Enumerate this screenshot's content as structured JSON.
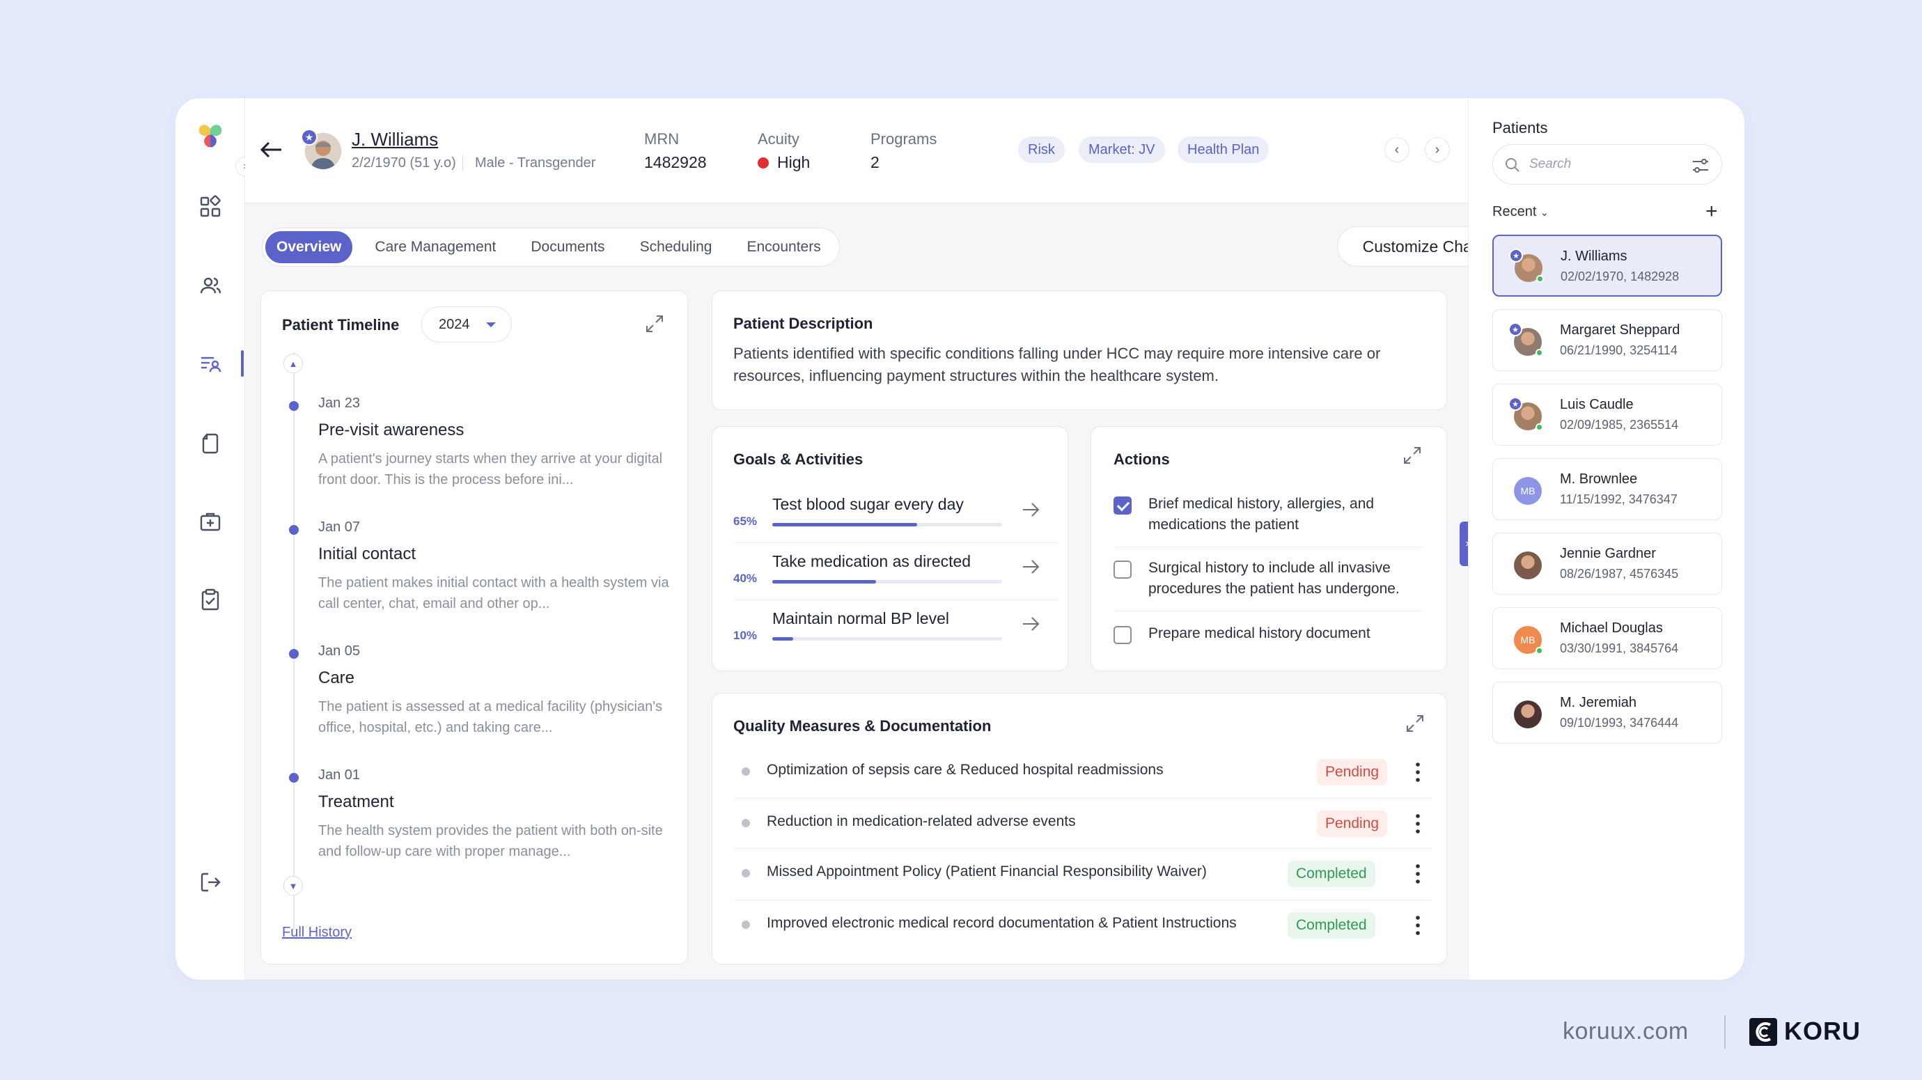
{
  "header": {
    "patient_name": "J. Williams",
    "dob": "2/2/1970 (51 y.o)",
    "gender": "Male - Transgender",
    "mrn_label": "MRN",
    "mrn_value": "1482928",
    "acuity_label": "Acuity",
    "acuity_value": "High",
    "programs_label": "Programs",
    "programs_value": "2",
    "tags": [
      "Risk",
      "Market: JV",
      "Health Plan"
    ]
  },
  "tabs": [
    "Overview",
    "Care Management",
    "Documents",
    "Scheduling",
    "Encounters"
  ],
  "customize_button": "Customize Charts",
  "timeline": {
    "title": "Patient Timeline",
    "year": "2024",
    "items": [
      {
        "date": "Jan 23",
        "title": "Pre-visit awareness",
        "desc": "A patient's journey starts when they arrive at your digital front door. This is the process before ini..."
      },
      {
        "date": "Jan 07",
        "title": "Initial contact",
        "desc": "The patient makes initial contact with a health system via call center, chat, email and other op..."
      },
      {
        "date": "Jan 05",
        "title": "Care",
        "desc": "The patient is assessed at a medical facility (physician's office, hospital, etc.) and taking care..."
      },
      {
        "date": "Jan 01",
        "title": "Treatment",
        "desc": "The health system provides the patient with both on-site and follow-up care with proper manage..."
      }
    ],
    "full_history": "Full History"
  },
  "description": {
    "title": "Patient Description",
    "text": "Patients identified with specific conditions falling under HCC may require more intensive care or resources, influencing payment structures within the healthcare system."
  },
  "goals": {
    "title": "Goals & Activities",
    "items": [
      {
        "pct_label": "65%",
        "progress": 0.63,
        "text": "Test blood sugar every day"
      },
      {
        "pct_label": "40%",
        "progress": 0.45,
        "text": "Take medication as directed"
      },
      {
        "pct_label": "10%",
        "progress": 0.09,
        "text": "Maintain normal BP level"
      }
    ]
  },
  "actions": {
    "title": "Actions",
    "items": [
      {
        "text": "Brief medical history, allergies, and medications the patient",
        "checked": true
      },
      {
        "text": "Surgical history to include all invasive procedures the patient has undergone.",
        "checked": false
      },
      {
        "text": "Prepare medical history document",
        "checked": false
      }
    ]
  },
  "quality": {
    "title": "Quality Measures & Documentation",
    "items": [
      {
        "text": "Optimization of sepsis care & Reduced hospital readmissions",
        "status": "Pending"
      },
      {
        "text": "Reduction in medication-related adverse events",
        "status": "Pending"
      },
      {
        "text": "Missed Appointment Policy (Patient Financial Responsibility Waiver)",
        "status": "Completed"
      },
      {
        "text": "Improved electronic medical record documentation & Patient Instructions",
        "status": "Completed"
      }
    ]
  },
  "patients_panel": {
    "title": "Patients",
    "search_placeholder": "Search",
    "recent_label": "Recent",
    "patients": [
      {
        "name": "J. Williams",
        "meta": "02/02/1970, 1482928",
        "initials": "",
        "color": "#b08a70",
        "starred": true,
        "online": true
      },
      {
        "name": "Margaret Sheppard",
        "meta": "06/21/1990, 3254114",
        "initials": "",
        "color": "#8e7a6e",
        "starred": true,
        "online": true
      },
      {
        "name": "Luis Caudle",
        "meta": "02/09/1985, 2365514",
        "initials": "",
        "color": "#a37f63",
        "starred": true,
        "online": true
      },
      {
        "name": "M. Brownlee",
        "meta": "11/15/1992, 3476347",
        "initials": "MB",
        "color": "#8F95E6",
        "starred": false,
        "online": false
      },
      {
        "name": "Jennie Gardner",
        "meta": "08/26/1987, 4576345",
        "initials": "",
        "color": "#7a5a4a",
        "starred": false,
        "online": false
      },
      {
        "name": "Michael Douglas",
        "meta": "03/30/1991, 3845764",
        "initials": "MB",
        "color": "#EE8A4E",
        "starred": false,
        "online": true
      },
      {
        "name": "M. Jeremiah",
        "meta": "09/10/1993, 3476444",
        "initials": "",
        "color": "#4a3330",
        "starred": false,
        "online": false
      }
    ]
  },
  "branding": {
    "url": "koruux.com",
    "name": "KORU"
  },
  "colors": {
    "accent": "#5B62C9",
    "acuity_high": "#E02E32",
    "pending": "#D94A3D",
    "completed": "#2E9A55"
  }
}
